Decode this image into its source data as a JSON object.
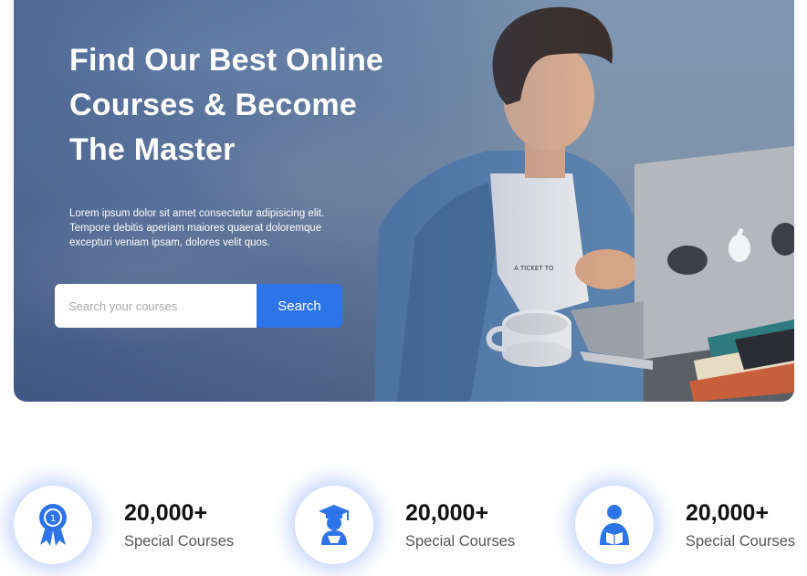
{
  "hero": {
    "title_lines": [
      "Find Our Best Online",
      "Courses & Become",
      "The Master"
    ],
    "description_lines": [
      "Lorem ipsum dolor sit amet consectetur adipisicing elit.",
      "Tempore debitis aperiam maiores quaerat doloremque",
      "excepturi veniam ipsam, dolores velit quos."
    ],
    "search": {
      "placeholder": "Search your courses",
      "value": "",
      "button_label": "Search"
    },
    "image": "person-with-laptop-photo",
    "accent_color": "#2d74e8"
  },
  "stats": [
    {
      "icon": "award-medal-icon",
      "value": "20,000+",
      "label": "Special Courses"
    },
    {
      "icon": "graduate-student-icon",
      "value": "20,000+",
      "label": "Special Courses"
    },
    {
      "icon": "reading-student-icon",
      "value": "20,000+",
      "label": "Special Courses"
    }
  ]
}
